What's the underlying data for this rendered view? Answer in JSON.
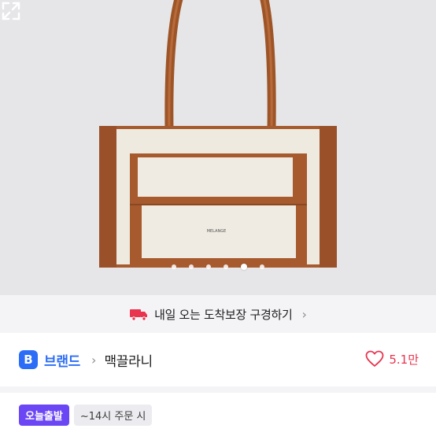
{
  "product_image": {
    "brand_mark": "MELANGE",
    "carousel_count": 6,
    "carousel_active_index": 4,
    "colors": {
      "background": "#e6e6e8",
      "canvas": "#eeeae0",
      "leather": "#a65a2e"
    }
  },
  "banner": {
    "text": "내일 오는 도착보장 구경하기",
    "chevron": "›",
    "icon": "truck-icon"
  },
  "brand": {
    "badge": "B",
    "label": "브랜드",
    "separator": "›",
    "name": "맥끌라니",
    "like_count": "5.1만",
    "like_icon": "heart-icon"
  },
  "delivery_tags": {
    "primary": "오늘출발",
    "secondary": "~14시 주문 시"
  },
  "colors": {
    "accent": "#2b6df6",
    "like": "#e8344e",
    "tag": "#6b46f5",
    "truck": "#e8344e"
  }
}
